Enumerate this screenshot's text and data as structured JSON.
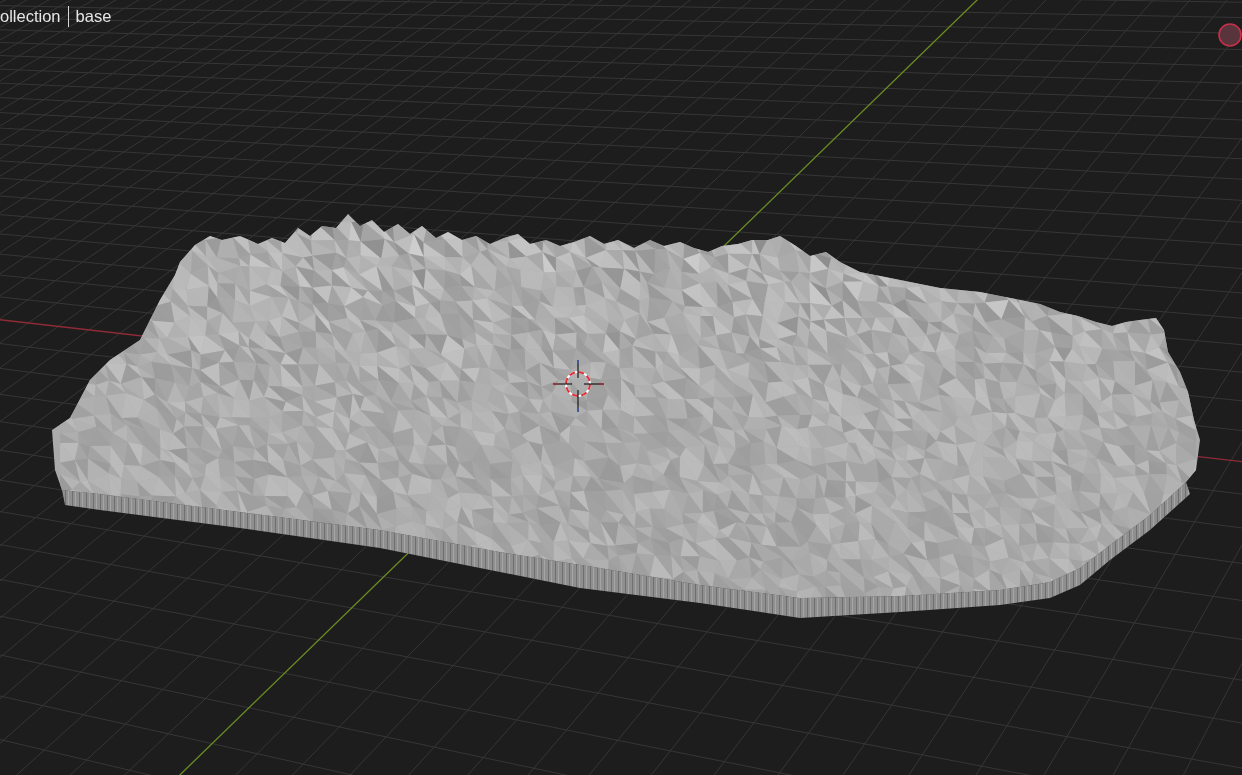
{
  "viewport": {
    "collection": "ollection",
    "object": "base"
  }
}
